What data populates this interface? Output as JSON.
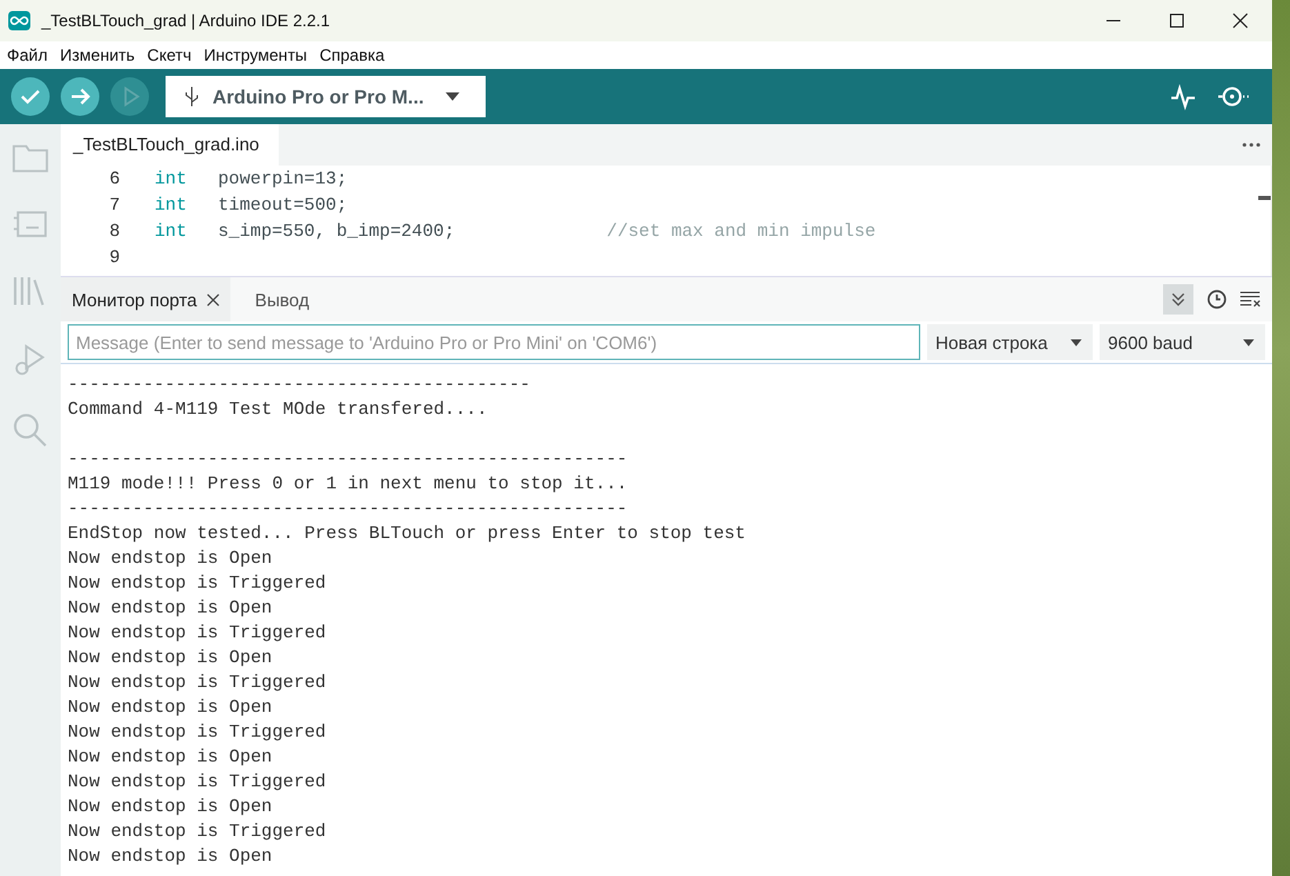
{
  "window": {
    "title": "_TestBLTouch_grad | Arduino IDE 2.2.1"
  },
  "menu": [
    "Файл",
    "Изменить",
    "Скетч",
    "Инструменты",
    "Справка"
  ],
  "board": {
    "label": "Arduino Pro or Pro M..."
  },
  "editor": {
    "file_tab": "_TestBLTouch_grad.ino",
    "lines": [
      {
        "number": "6",
        "keyword": "int",
        "code": "powerpin=13;"
      },
      {
        "number": "7",
        "keyword": "int",
        "code": "timeout=500;"
      },
      {
        "number": "8",
        "keyword": "int",
        "code": "s_imp=550, b_imp=2400;",
        "comment": "//set max and min impulse"
      },
      {
        "number": "9"
      }
    ]
  },
  "panel": {
    "tabs": [
      {
        "label": "Монитор порта",
        "selected": true,
        "closable": true
      },
      {
        "label": "Вывод",
        "selected": false,
        "closable": false
      }
    ],
    "message": {
      "placeholder": "Message (Enter to send message to 'Arduino Pro or Pro Mini' on 'COM6')"
    },
    "line_ending": "Новая строка",
    "baud": "9600 baud",
    "output": [
      {
        "text": "-------------------------------------------"
      },
      {
        "text": "Command 4-M119 Test MOde transfered...."
      },
      {
        "text": "----------------------------------------------------",
        "gap_before": true
      },
      {
        "text": "M119 mode!!! Press 0 or 1 in next menu to stop it..."
      },
      {
        "text": "----------------------------------------------------"
      },
      {
        "text": "EndStop now tested... Press BLTouch or press Enter to stop test"
      },
      {
        "text": "Now endstop is Open"
      },
      {
        "text": "Now endstop is Triggered"
      },
      {
        "text": "Now endstop is Open"
      },
      {
        "text": "Now endstop is Triggered"
      },
      {
        "text": "Now endstop is Open"
      },
      {
        "text": "Now endstop is Triggered"
      },
      {
        "text": "Now endstop is Open"
      },
      {
        "text": "Now endstop is Triggered"
      },
      {
        "text": "Now endstop is Open"
      },
      {
        "text": "Now endstop is Triggered"
      },
      {
        "text": "Now endstop is Open"
      },
      {
        "text": "Now endstop is Triggered"
      },
      {
        "text": "Now endstop is Open"
      }
    ]
  }
}
